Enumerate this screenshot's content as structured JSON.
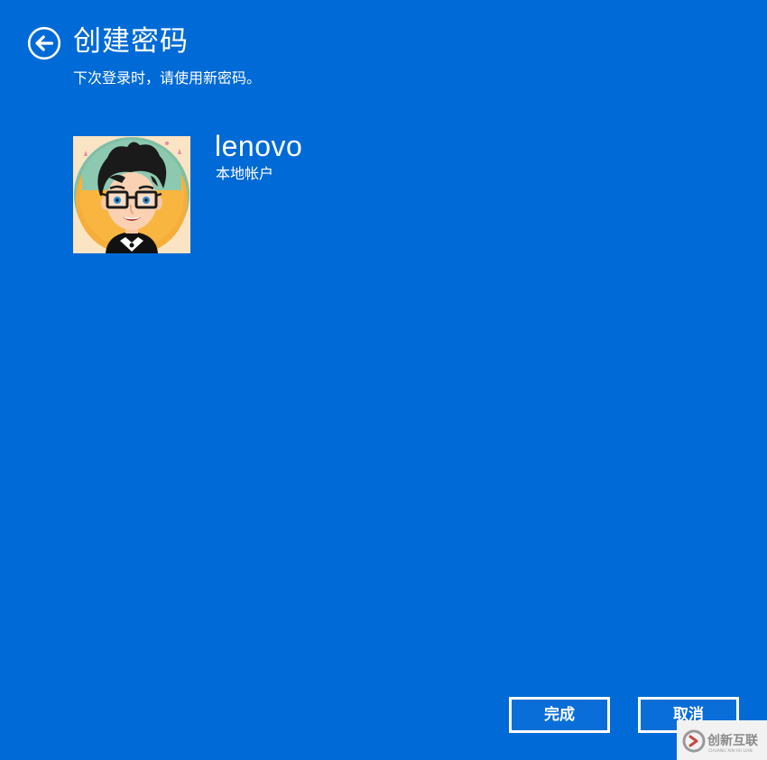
{
  "page": {
    "title": "创建密码",
    "subtitle": "下次登录时，请使用新密码。"
  },
  "header": {
    "back_icon": "back-arrow-circle-icon"
  },
  "account": {
    "name": "lenovo",
    "type": "本地帐户",
    "avatar": "cartoon-avatar-glasses"
  },
  "buttons": {
    "done_label": "完成",
    "cancel_label": "取消"
  },
  "watermark": {
    "brand": "创新互联",
    "tagline": "CHUANG XIN HU LIAN"
  },
  "colors": {
    "background": "#006ad6",
    "text": "#ffffff",
    "button_border": "#ffffff"
  }
}
